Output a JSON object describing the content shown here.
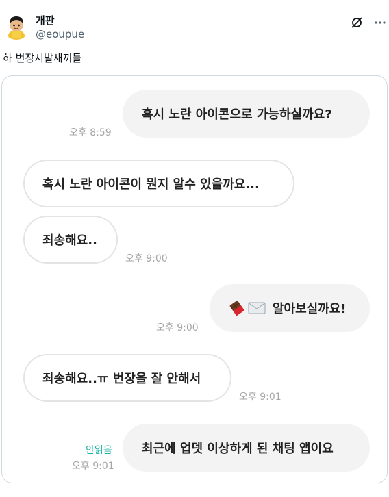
{
  "tweet": {
    "display_name": "개판",
    "handle": "@eoupue",
    "text": "하 번장시발새끼들"
  },
  "icons": {
    "avatar": "cartoon-character-avatar",
    "grok": "grok-icon",
    "more": "more-dots-icon",
    "chocolate": "chocolate-bar-emoji",
    "envelope": "envelope-emoji"
  },
  "colors": {
    "outgoing_bubble": "#f3f3f3",
    "incoming_border": "#e4e4e4",
    "timestamp": "#a6a6a6",
    "unread": "#1fb5a5"
  },
  "chat": {
    "messages": [
      {
        "direction": "out",
        "text": "혹시 노란 아이콘으로 가능하실까요?",
        "time": "오후 8:59"
      },
      {
        "direction": "in",
        "text": "혹시 노란 아이콘이 뭔지 알수 있을까요...",
        "time": ""
      },
      {
        "direction": "in",
        "text": "죄송해요..",
        "time": "오후 9:00"
      },
      {
        "direction": "out",
        "text": "알아보실까요!",
        "time": "오후 9:00"
      },
      {
        "direction": "in",
        "text": "죄송해요..ㅠ 번장을 잘 안해서",
        "time": "오후 9:01"
      },
      {
        "direction": "out",
        "text": "최근에 업뎃 이상하게 된 채팅 앱이요",
        "time": "오후 9:01",
        "status": "안읽음"
      }
    ]
  }
}
